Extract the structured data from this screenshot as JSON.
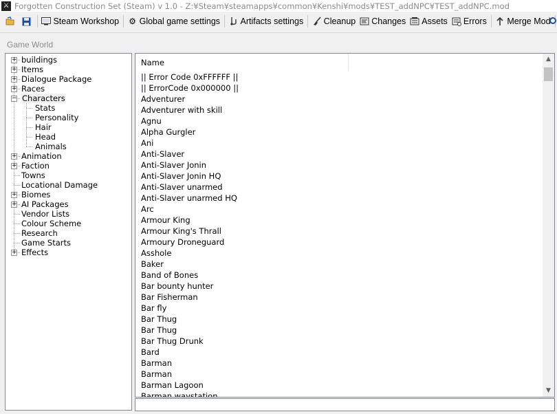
{
  "window": {
    "title": "Forgotten Construction Set (Steam) v 1.0 - Z:¥Steam¥steamapps¥common¥Kenshi¥mods¥TEST_addNPC¥TEST_addNPC.mod"
  },
  "toolbar": {
    "buttons": [
      {
        "label": "",
        "icon": "open-folder-icon"
      },
      {
        "label": "",
        "icon": "save-icon"
      },
      {
        "label": "Steam Workshop",
        "icon": "workshop-icon"
      },
      {
        "label": "Global game settings",
        "icon": "gear-icon"
      },
      {
        "label": "Artifacts settings",
        "icon": "artifacts-icon"
      },
      {
        "label": "Cleanup",
        "icon": "broom-icon"
      },
      {
        "label": "Changes",
        "icon": "changes-icon"
      },
      {
        "label": "Assets",
        "icon": "assets-icon"
      },
      {
        "label": "Errors",
        "icon": "errors-icon"
      },
      {
        "label": "Merge Mod",
        "icon": "merge-icon"
      }
    ]
  },
  "group_label": "Game World",
  "tree": {
    "items": [
      {
        "label": "buildings",
        "expander": "+",
        "level": 0
      },
      {
        "label": "Items",
        "expander": "+",
        "level": 0
      },
      {
        "label": "Dialogue Package",
        "expander": "+",
        "level": 0
      },
      {
        "label": "Races",
        "expander": "+",
        "level": 0
      },
      {
        "label": "Characters",
        "expander": "−",
        "level": 0,
        "selected": true
      },
      {
        "label": "Stats",
        "expander": "",
        "level": 1
      },
      {
        "label": "Personality",
        "expander": "",
        "level": 1
      },
      {
        "label": "Hair",
        "expander": "",
        "level": 1
      },
      {
        "label": "Head",
        "expander": "",
        "level": 1
      },
      {
        "label": "Animals",
        "expander": "",
        "level": 1
      },
      {
        "label": "Animation",
        "expander": "+",
        "level": 0
      },
      {
        "label": "Faction",
        "expander": "+",
        "level": 0
      },
      {
        "label": "Towns",
        "expander": "",
        "level": 0
      },
      {
        "label": "Locational Damage",
        "expander": "",
        "level": 0
      },
      {
        "label": "Biomes",
        "expander": "+",
        "level": 0
      },
      {
        "label": "AI Packages",
        "expander": "+",
        "level": 0
      },
      {
        "label": "Vendor Lists",
        "expander": "",
        "level": 0
      },
      {
        "label": "Colour Scheme",
        "expander": "",
        "level": 0
      },
      {
        "label": "Research",
        "expander": "",
        "level": 0
      },
      {
        "label": "Game Starts",
        "expander": "",
        "level": 0
      },
      {
        "label": "Effects",
        "expander": "+",
        "level": 0
      }
    ]
  },
  "list": {
    "column_header": "Name",
    "items": [
      "|| Error Code 0xFFFFFF ||",
      "|| ErrorCode 0x000000 ||",
      "Adventurer",
      "Adventurer with skill",
      "Agnu",
      "Alpha Gurgler",
      "Ani",
      "Anti-Slaver",
      "Anti-Slaver Jonin",
      "Anti-Slaver Jonin HQ",
      "Anti-Slaver unarmed",
      "Anti-Slaver unarmed HQ",
      "Arc",
      "Armour King",
      "Armour King's Thrall",
      "Armoury Droneguard",
      "Asshole",
      "Baker",
      "Band of Bones",
      "Bar bounty hunter",
      "Bar Fisherman",
      "Bar fly",
      "Bar Thug",
      "Bar Thug",
      "Bar Thug Drunk",
      "Bard",
      "Barman",
      "Barman",
      "Barman Lagoon",
      "Barman waystation"
    ]
  }
}
